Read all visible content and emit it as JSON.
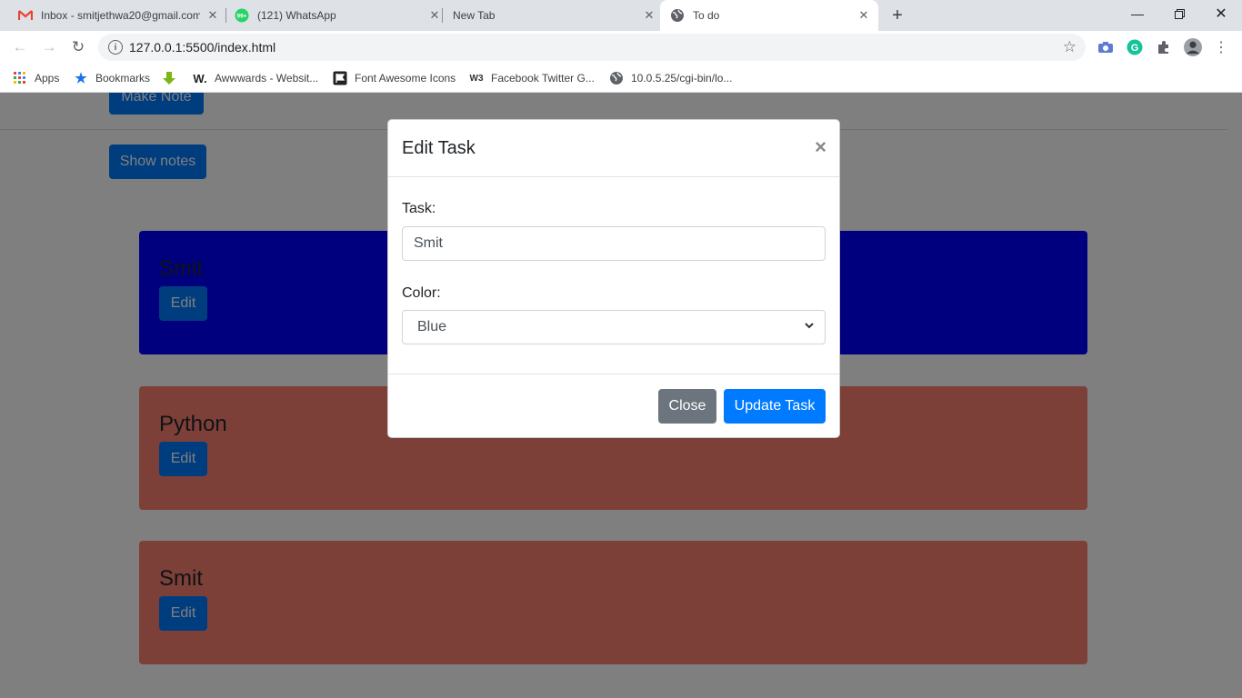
{
  "browser": {
    "tabs": [
      {
        "title": "Inbox - smitjethwa20@gmail.com"
      },
      {
        "title": "(121) WhatsApp"
      },
      {
        "title": "New Tab"
      },
      {
        "title": "To do"
      }
    ],
    "whatsapp_badge": "99+",
    "url": "127.0.0.1:5500/index.html",
    "bookmarks": [
      {
        "label": "Apps"
      },
      {
        "label": "Bookmarks"
      },
      {
        "label": ""
      },
      {
        "label": "Awwwards - Websit..."
      },
      {
        "label": "Font Awesome Icons"
      },
      {
        "label": "Facebook Twitter G..."
      },
      {
        "label": "10.0.5.25/cgi-bin/lo..."
      }
    ],
    "bookmark_glyphs": {
      "awwwards": "W.",
      "w3": "W3"
    }
  },
  "page": {
    "make_note_label": "Make Note",
    "show_notes_label": "Show notes",
    "cards": [
      {
        "title": "Smit",
        "edit_label": "Edit",
        "color": "#0000ff"
      },
      {
        "title": "Python",
        "edit_label": "Edit",
        "color": "#fa8072"
      },
      {
        "title": "Smit",
        "edit_label": "Edit",
        "color": "#fa8072"
      }
    ]
  },
  "modal": {
    "title": "Edit Task",
    "task_label": "Task:",
    "task_value": "Smit",
    "color_label": "Color:",
    "color_value": "Blue",
    "close_label": "Close",
    "update_label": "Update Task"
  },
  "colors": {
    "primary": "#007bff",
    "secondary": "#6c757d",
    "backdrop": "rgba(0,0,0,0.5)"
  }
}
